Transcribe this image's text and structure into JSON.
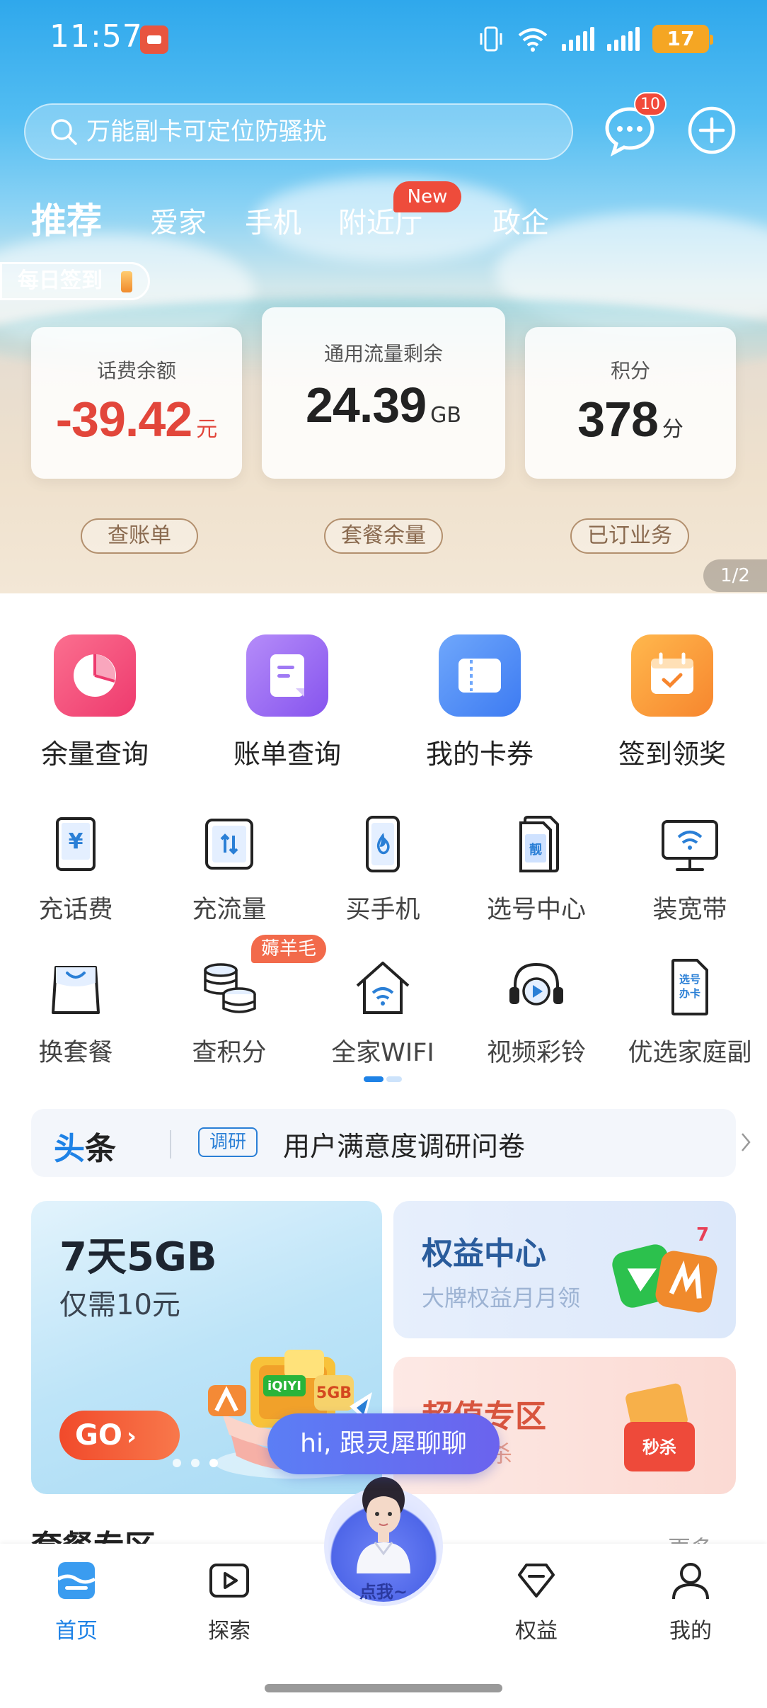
{
  "status_bar": {
    "time": "11:57",
    "battery": "17"
  },
  "search": {
    "placeholder": "万能副卡可定位防骚扰"
  },
  "header": {
    "message_badge": "10"
  },
  "tabs": [
    {
      "label": "推荐"
    },
    {
      "label": "爱家"
    },
    {
      "label": "手机"
    },
    {
      "label": "附近厅"
    },
    {
      "label": "政企"
    }
  ],
  "new_badge": "New",
  "daily_signin": "每日签到",
  "account_cards": [
    {
      "label": "话费余额",
      "value": "-39.42",
      "unit": "元",
      "button": "查账单"
    },
    {
      "label": "通用流量剩余",
      "value": "24.39",
      "unit": "GB",
      "button": "套餐余量"
    },
    {
      "label": "积分",
      "value": "378",
      "unit": "分",
      "button": "已订业务"
    }
  ],
  "banner_pager": "1/2",
  "main_services": [
    {
      "label": "余量查询",
      "icon": "pie-chart-icon",
      "color": "#f0457a"
    },
    {
      "label": "账单查询",
      "icon": "bill-icon",
      "color": "#9b6df3"
    },
    {
      "label": "我的卡券",
      "icon": "coupon-icon",
      "color": "#4f8cf5"
    },
    {
      "label": "签到领奖",
      "icon": "calendar-icon",
      "color": "#f7953a"
    }
  ],
  "services_row1": [
    {
      "label": "充话费",
      "icon": "recharge-call-icon"
    },
    {
      "label": "充流量",
      "icon": "recharge-data-icon"
    },
    {
      "label": "买手机",
      "icon": "buy-phone-icon"
    },
    {
      "label": "选号中心",
      "icon": "number-select-icon"
    },
    {
      "label": "装宽带",
      "icon": "broadband-icon"
    }
  ],
  "services_row2": [
    {
      "label": "换套餐",
      "icon": "change-plan-icon"
    },
    {
      "label": "查积分",
      "icon": "points-icon"
    },
    {
      "label": "全家WIFI",
      "icon": "home-wifi-icon"
    },
    {
      "label": "视频彩铃",
      "icon": "video-ringtone-icon"
    },
    {
      "label": "优选家庭副",
      "icon": "family-card-icon"
    }
  ],
  "points_tag": "薅羊毛",
  "news": {
    "head_a": "头",
    "head_b": "条",
    "tag": "调研",
    "text": "用户满意度调研问卷"
  },
  "promo_main": {
    "title": "7天5GB",
    "subtitle": "仅需10元",
    "button": "GO"
  },
  "promo_rights": {
    "title": "权益中心",
    "subtitle": "大牌权益月月领"
  },
  "promo_value": {
    "title": "超值专区",
    "subtitle": "流量秒杀",
    "seckill": "秒杀"
  },
  "packages_section": {
    "title": "套餐专区",
    "more": "更多"
  },
  "assistant": {
    "bubble": "hi, 跟灵犀聊聊",
    "button": "点我~"
  },
  "bottom_nav": [
    {
      "label": "首页"
    },
    {
      "label": "探索"
    },
    {
      "label": "权益"
    },
    {
      "label": "我的"
    }
  ],
  "colors": {
    "accent": "#1e82e6",
    "negative": "#e2463b",
    "go": "#f14a2b"
  }
}
